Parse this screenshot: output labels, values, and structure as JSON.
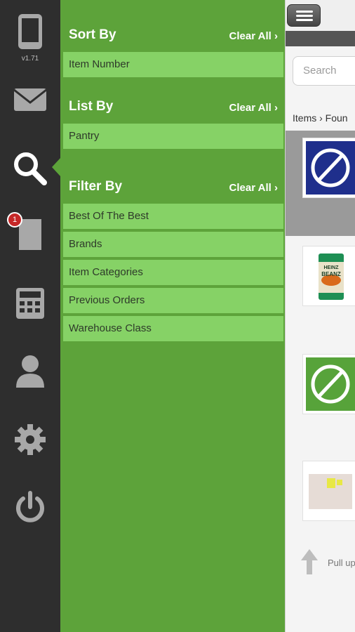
{
  "sidebar": {
    "version": "v1.71",
    "icons": [
      "tablet-icon",
      "mail-icon",
      "search-icon",
      "document-icon",
      "calculator-icon",
      "user-icon",
      "gear-icon",
      "power-icon"
    ],
    "badge_count": "1"
  },
  "filter_panel": {
    "sort_by": {
      "title": "Sort By",
      "clear": "Clear All ›",
      "options": [
        "Item Number"
      ]
    },
    "list_by": {
      "title": "List By",
      "clear": "Clear All ›",
      "options": [
        "Pantry"
      ]
    },
    "filter_by": {
      "title": "Filter By",
      "clear": "Clear All ›",
      "options": [
        "Best Of The Best",
        "Brands",
        "Item Categories",
        "Previous Orders",
        "Warehouse Class"
      ]
    }
  },
  "content": {
    "search_placeholder": "Search",
    "breadcrumb": "Items › Foun",
    "pull_text": "Pull up",
    "product_label_top": "HEINZ",
    "product_label_main": "BEANZ"
  },
  "colors": {
    "panel_green": "#5da33a",
    "option_green": "#86d266",
    "rail_dark": "#2e2e2e",
    "badge_red": "#c62828"
  }
}
